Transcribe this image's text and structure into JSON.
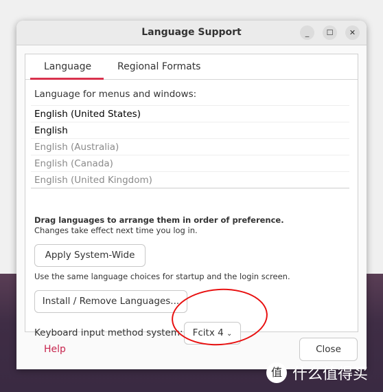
{
  "window": {
    "title": "Language Support",
    "minimize": "_",
    "maximize": "☐",
    "close": "✕"
  },
  "tabs": [
    {
      "label": "Language",
      "active": true
    },
    {
      "label": "Regional Formats",
      "active": false
    }
  ],
  "language_tab": {
    "heading": "Language for menus and windows:",
    "languages": [
      {
        "label": "English (United States)",
        "enabled": true
      },
      {
        "label": "English",
        "enabled": true
      },
      {
        "label": "English (Australia)",
        "enabled": false
      },
      {
        "label": "English (Canada)",
        "enabled": false
      },
      {
        "label": "English (United Kingdom)",
        "enabled": false
      }
    ],
    "drag_hint": "Drag languages to arrange them in order of preference.",
    "drag_note": "Changes take effect next time you log in.",
    "apply_button": "Apply System-Wide",
    "apply_note": "Use the same language choices for startup and the login screen.",
    "install_button": "Install / Remove Languages...",
    "input_method_label": "Keyboard input method system:",
    "input_method_value": "Fcitx 4"
  },
  "footer": {
    "help": "Help",
    "close": "Close"
  },
  "accent_color": "#d9324d",
  "annotation_color": "#e81010",
  "watermark": {
    "logo": "值",
    "text": "什么值得买"
  }
}
